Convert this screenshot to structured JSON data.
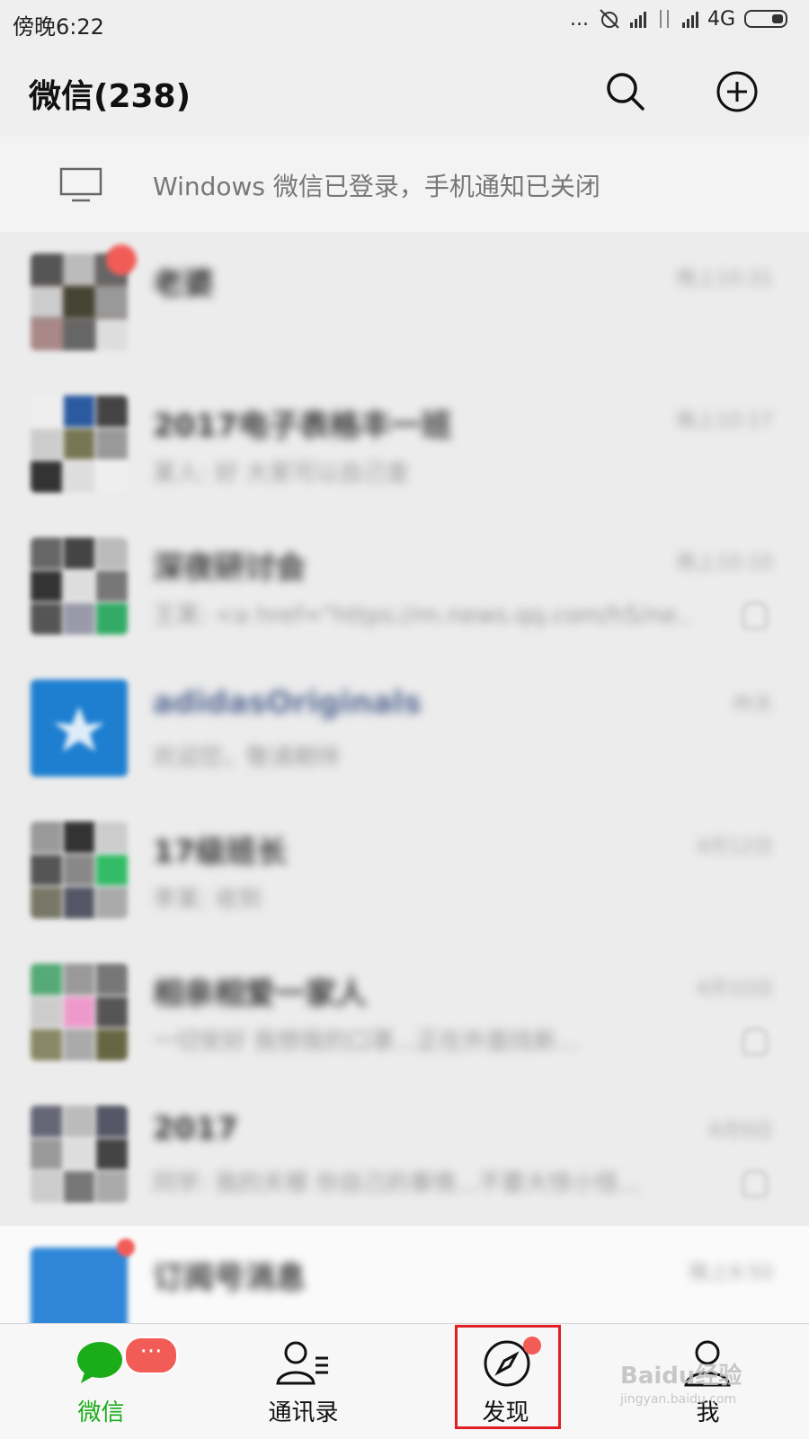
{
  "status_bar": {
    "time": "傍晚6:22",
    "network": "4G",
    "dots": "..."
  },
  "header": {
    "title": "微信(238)",
    "search_icon": "search-icon",
    "add_icon": "plus-circle-icon"
  },
  "notice": {
    "text": "Windows 微信已登录，手机通知已关闭",
    "icon": "monitor-icon"
  },
  "chats": [
    {
      "name": "老婆",
      "preview": "",
      "time": "晚上10:31",
      "muted": false,
      "badge": true
    },
    {
      "name": "2017电子表格丰一班",
      "preview": "某人: 好 大家可以自己查",
      "time": "晚上10:17",
      "muted": false,
      "badge": false
    },
    {
      "name": "深夜研讨会",
      "preview": "王某: <a href=\"https://m.news.qq.com/h5/ne...",
      "time": "晚上10:10",
      "muted": true,
      "badge": false
    },
    {
      "name": "adidasOriginals",
      "preview": "欢迎您，敬请期待",
      "time": "昨天",
      "muted": false,
      "badge": false
    },
    {
      "name": "17级班长",
      "preview": "李某: 收到",
      "time": "4月12日",
      "muted": false,
      "badge": false
    },
    {
      "name": "相亲相爱一家人",
      "preview": "一切安好 我想我的口罩...正在外面找新...",
      "time": "4月10日",
      "muted": true,
      "badge": false
    },
    {
      "name": "2017",
      "preview": "同学: 我的天哪 你自己的事情...不要大惊小怪...",
      "time": "4月9日",
      "muted": true,
      "badge": false
    },
    {
      "name": "订阅号消息",
      "preview": "",
      "time": "晚上9:50",
      "muted": false,
      "badge": true
    }
  ],
  "tabs": [
    {
      "label": "微信",
      "icon": "chat-bubble-icon",
      "active": true,
      "badge": "···"
    },
    {
      "label": "通讯录",
      "icon": "contacts-icon",
      "active": false
    },
    {
      "label": "发现",
      "icon": "compass-icon",
      "active": false,
      "dot": true
    },
    {
      "label": "我",
      "icon": "person-icon",
      "active": false
    }
  ],
  "watermark": {
    "text": "Baidu经验",
    "sub": "jingyan.baidu.com"
  },
  "colors": {
    "accent_green": "#1aad19",
    "badge_red": "#f25c57",
    "highlight_red": "#e01f26"
  }
}
